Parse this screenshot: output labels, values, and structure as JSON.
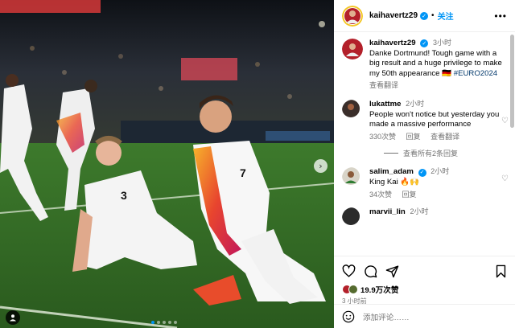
{
  "post": {
    "author": "kaihavertz29",
    "follow_label": "关注",
    "sep": "•",
    "more": "•••",
    "caption": {
      "username": "kaihavertz29",
      "time": "3小时",
      "text": "Danke Dortmund! Tough game with a big result and a huge privilege to make my 50th appearance 🇩🇪 ",
      "hashtag": "#EURO2024",
      "translate": "查看翻译"
    },
    "comments": [
      {
        "username": "lukattme",
        "time": "2小时",
        "text": "People won't notice but yesterday you made a massive performance",
        "likes": "330次赞",
        "reply": "回复",
        "translate": "查看翻译",
        "view_replies": "查看所有2条回复"
      },
      {
        "username": "salim_adam",
        "time": "2小时",
        "text": "King Kai 🔥🙌",
        "likes": "34次赞",
        "reply": "回复"
      },
      {
        "username": "marvii_lin",
        "time": "2小时"
      }
    ],
    "likes_count": "19.9万次赞",
    "post_time": "3 小时前",
    "comment_placeholder": "添加评论……",
    "nav_next": "›"
  },
  "icons": {
    "like": "heart-icon",
    "comment": "comment-icon",
    "share": "share-icon",
    "save": "bookmark-icon",
    "emoji": "emoji-icon",
    "tag": "user-tag-icon"
  },
  "colors": {
    "accent": "#0095f6",
    "secondary_text": "#737373",
    "hashtag": "#00376b"
  }
}
